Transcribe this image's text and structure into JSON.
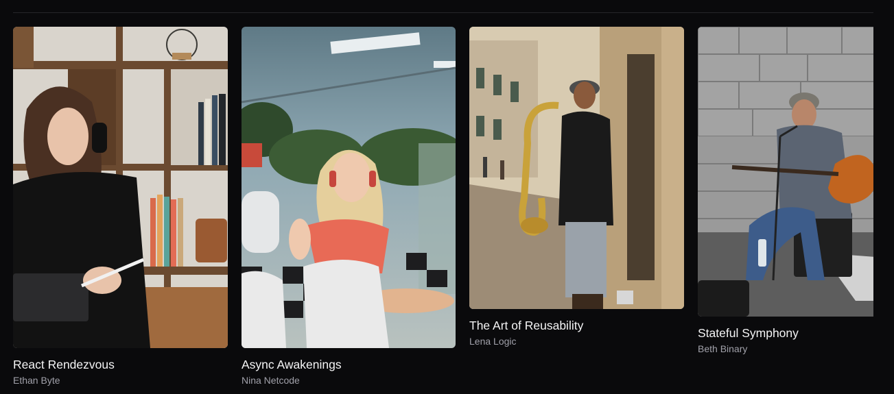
{
  "albums": [
    {
      "title": "React Rendezvous",
      "artist": "Ethan Byte",
      "cover": "woman-with-headphones-drawing-on-tablet"
    },
    {
      "title": "Async Awakenings",
      "artist": "Nina Netcode",
      "cover": "blonde-woman-with-red-headphones-behind-glass"
    },
    {
      "title": "The Art of Reusability",
      "artist": "Lena Logic",
      "cover": "saxophone-player-on-street"
    },
    {
      "title": "Stateful Symphony",
      "artist": "Beth Binary",
      "cover": "street-guitarist-with-amp"
    }
  ]
}
